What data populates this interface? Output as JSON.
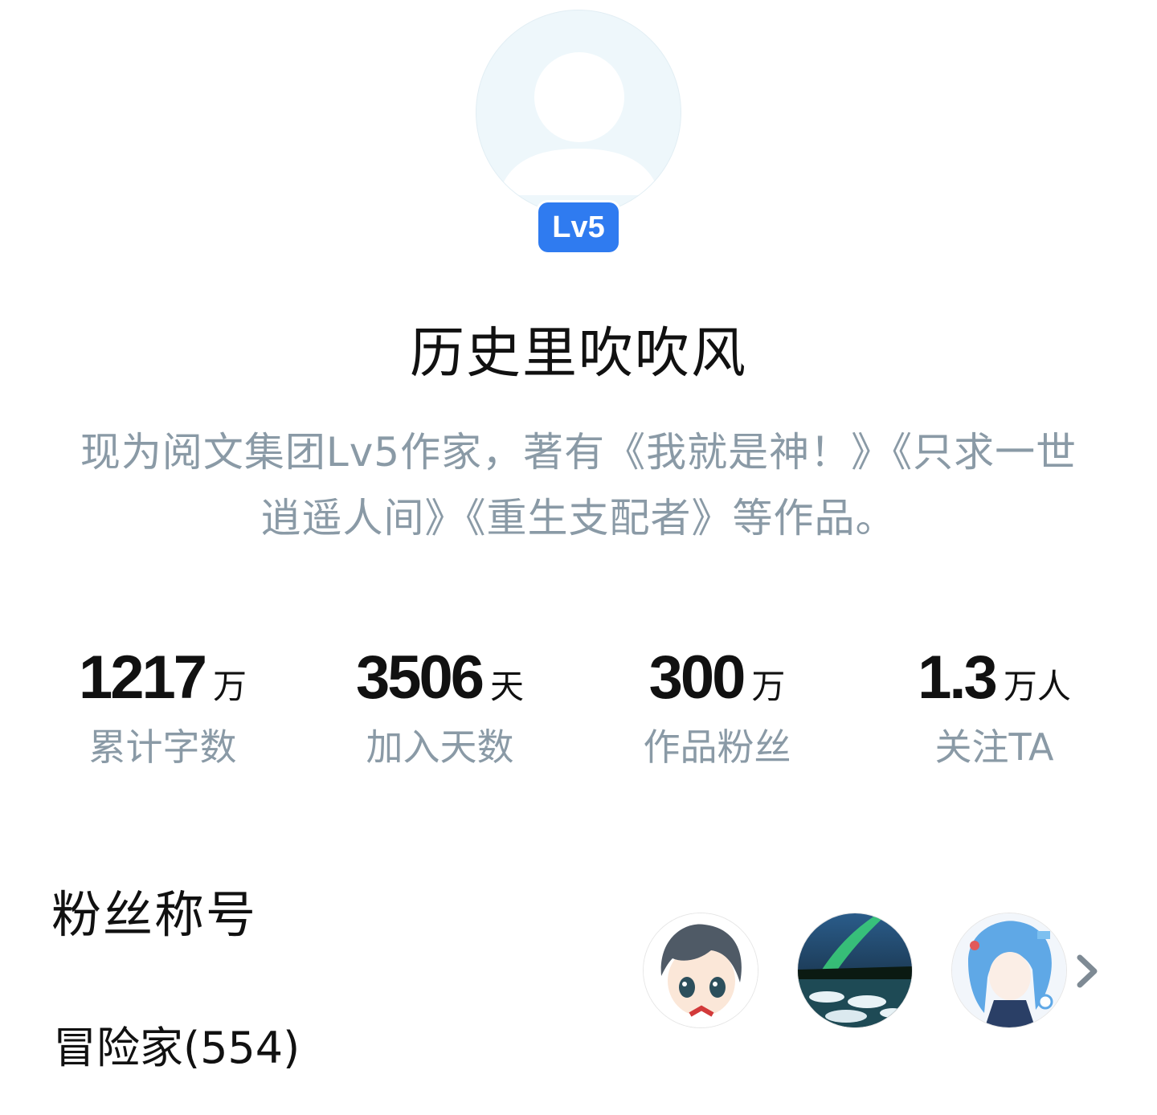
{
  "profile": {
    "level_badge": "Lv5",
    "name": "历史里吹吹风",
    "bio": "现为阅文集团Lv5作家，著有《我就是神！》《只求一世逍遥人间》《重生支配者》等作品。",
    "avatar_icon": "default-user-avatar-icon"
  },
  "stats": [
    {
      "value": "1217",
      "unit": "万",
      "label": "累计字数"
    },
    {
      "value": "3506",
      "unit": "天",
      "label": "加入天数"
    },
    {
      "value": "300",
      "unit": "万",
      "label": "作品粉丝"
    },
    {
      "value": "1.3",
      "unit": "万人",
      "label": "关注TA"
    }
  ],
  "fans": {
    "section_title": "粉丝称号",
    "title_label": "冒险家(554)",
    "avatars": [
      "anime-boy-avatar",
      "aurora-landscape-avatar",
      "anime-girl-avatar"
    ],
    "more_icon": "chevron-right-icon"
  },
  "colors": {
    "accent": "#2f7bf0",
    "muted_text": "#8a9aa6",
    "primary_text": "#111111"
  }
}
